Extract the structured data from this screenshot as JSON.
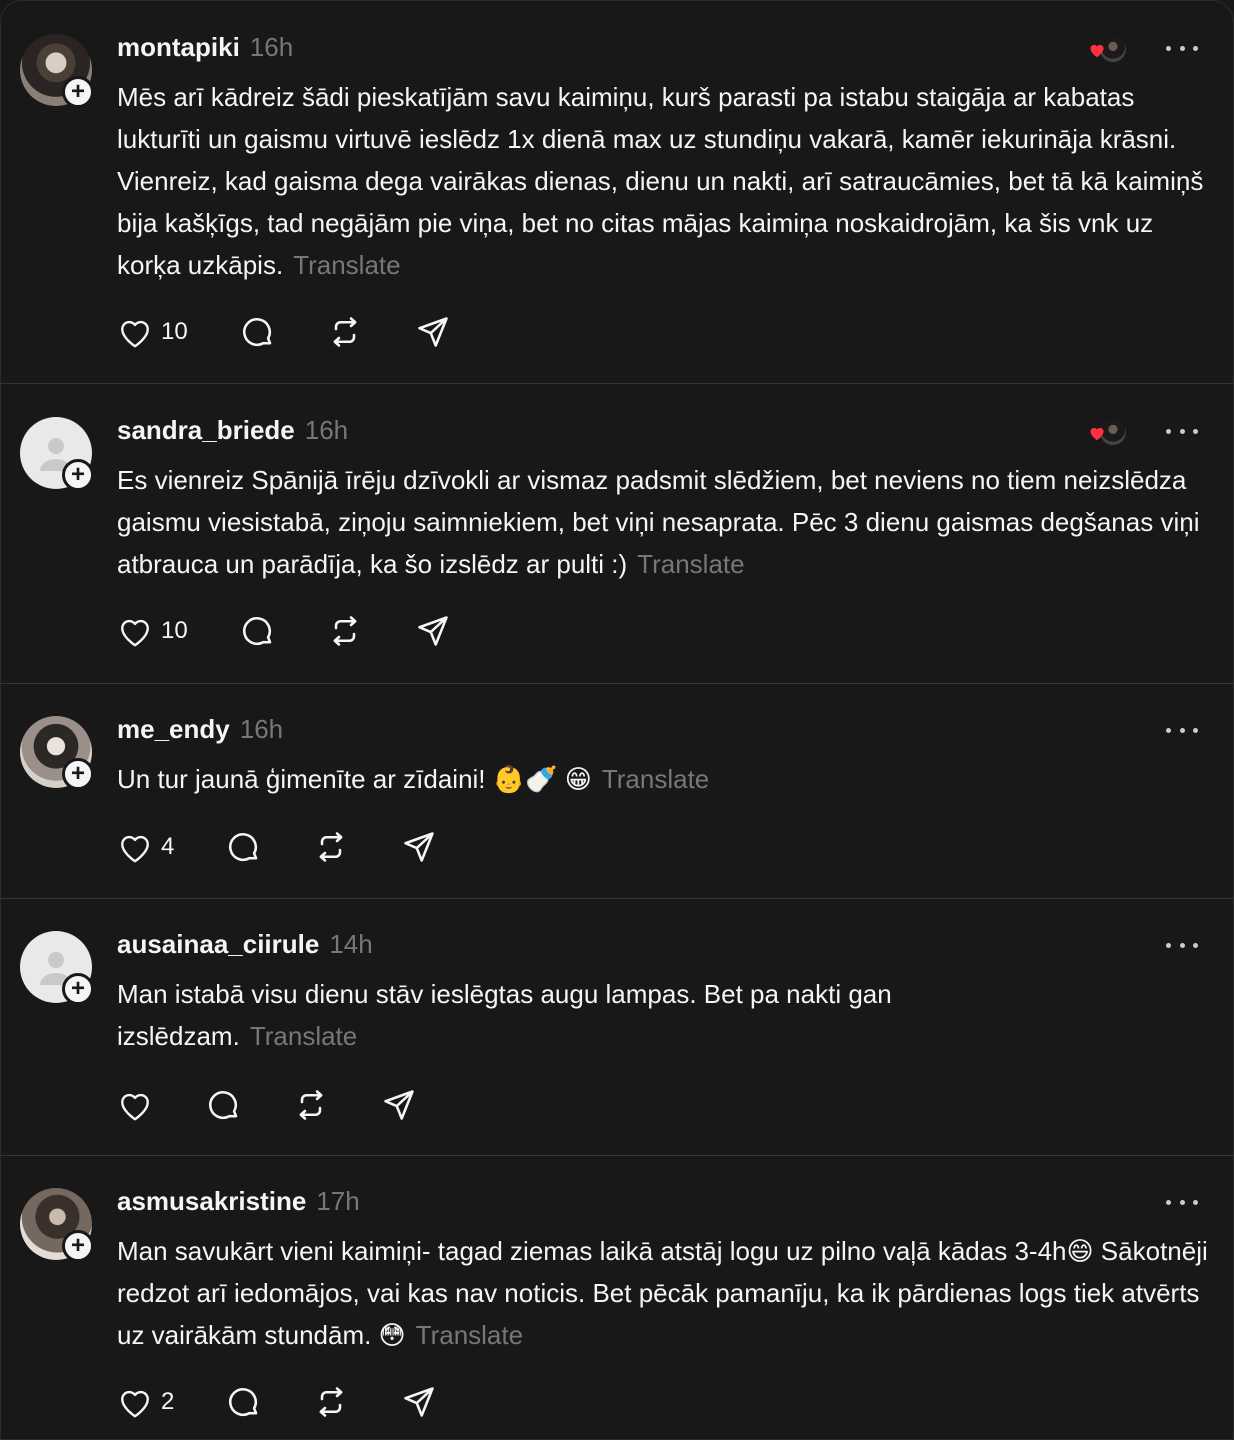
{
  "posts": [
    {
      "username": "montapiki",
      "time": "16h",
      "text": "Mēs arī kādreiz šādi pieskatījām savu kaimiņu, kurš parasti pa istabu staigāja ar kabatas lukturīti un gaismu virtuvē ieslēdz 1x dienā max uz stundiņu vakarā, kamēr iekurināja krāsni. Vienreiz, kad gaisma dega vairākas dienas, dienu un nakti, arī satraucāmies, bet tā kā kaimiņš bija kašķīgs, tad negājām pie viņa, bet no citas mājas kaimiņa noskaidrojām, ka šis vnk uz korķa uzkāpis.",
      "translate": "Translate",
      "likes": "10"
    },
    {
      "username": "sandra_briede",
      "time": "16h",
      "text": "Es vienreiz Spānijā īrēju dzīvokli ar vismaz padsmit slēdžiem, bet neviens no tiem neizslēdza gaismu viesistabā, ziņoju saimniekiem, bet viņi nesaprata. Pēc 3 dienu gaismas degšanas viņi atbrauca un parādīja, ka šo izslēdz ar pulti :)",
      "translate": "Translate",
      "likes": "10"
    },
    {
      "username": "me_endy",
      "time": "16h",
      "text": "Un tur jaunā ģimenīte ar zīdaini! 👶🍼 😁",
      "translate": "Translate",
      "likes": "4"
    },
    {
      "username": "ausainaa_ciirule",
      "time": "14h",
      "text": "Man istabā visu dienu stāv ieslēgtas augu lampas. Bet pa nakti gan izslēdzam.",
      "translate": "Translate",
      "likes": ""
    },
    {
      "username": "asmusakristine",
      "time": "17h",
      "text": "Man savukārt vieni kaimiņi- tagad ziemas laikā atstāj logu uz pilno vaļā kādas 3-4h😄 Sākotnēji redzot arī iedomājos, vai kas nav noticis. Bet pēcāk pamanīju, ka ik pārdienas logs tiek atvērts uz vairākām stundām. 😳",
      "translate": "Translate",
      "likes": "2"
    }
  ],
  "icons": {
    "like": "heart-icon",
    "reply": "comment-icon",
    "repost": "repost-icon",
    "share": "send-icon",
    "more": "more-icon",
    "follow": "plus-icon",
    "liked_by_author": "heart-red-icon"
  },
  "colors": {
    "background": "#181818",
    "text": "#f3f5f7",
    "muted": "#777777",
    "heart": "#ff3040"
  }
}
